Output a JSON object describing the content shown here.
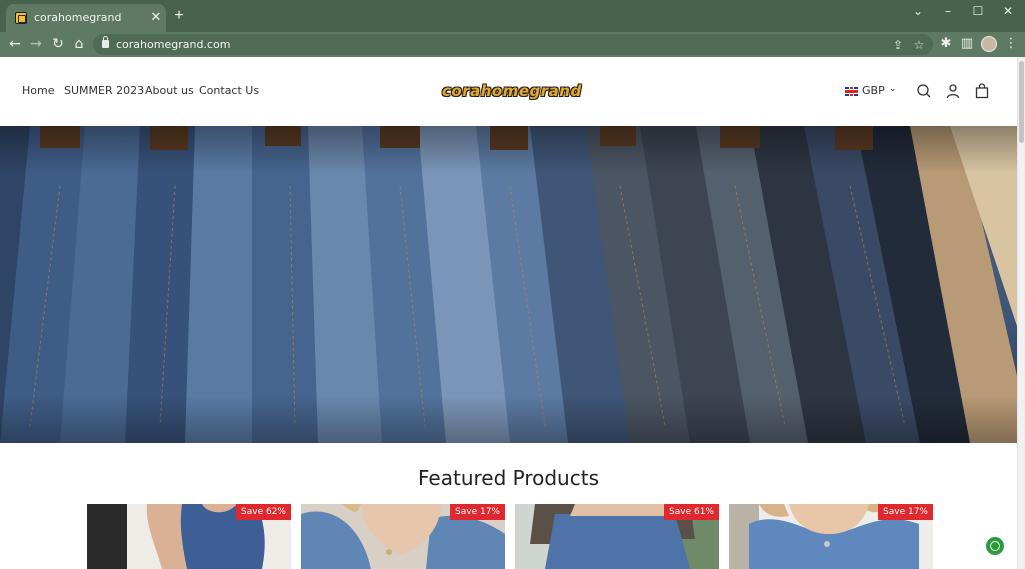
{
  "browser": {
    "tab_title": "corahomegrand",
    "tab_close": "✕",
    "new_tab": "+",
    "url": "corahomegrand.com",
    "window_controls": {
      "chevron": "⌄",
      "minimize": "–",
      "maximize": "☐",
      "close": "✕"
    },
    "nav": {
      "back": "←",
      "forward": "→",
      "reload": "↻",
      "home": "⌂"
    },
    "icons": {
      "share": "⇪",
      "star": "☆",
      "extensions": "✱",
      "sidepanel": "▥",
      "menu": "⋮"
    }
  },
  "site": {
    "nav_links": [
      "Home",
      "SUMMER 2023",
      "About us",
      "Contact Us"
    ],
    "logo_text": "corahomegrand",
    "currency": "GBP",
    "currency_chevron": "⌄"
  },
  "main": {
    "featured_title": "Featured Products",
    "products": [
      {
        "badge": "Save 62%",
        "image_icon": "product-dress-image"
      },
      {
        "badge": "Save 17%",
        "image_icon": "product-denim-shirt-image"
      },
      {
        "badge": "Save 61%",
        "image_icon": "product-denim-skirt-image"
      },
      {
        "badge": "Save 17%",
        "image_icon": "product-denim-top-image"
      }
    ]
  },
  "colors": {
    "chrome_titlebar": "#47634e",
    "chrome_toolbar": "#5f7a64",
    "badge_red": "#e0282f",
    "logo_orange": "#e8a62a",
    "chat_green": "#2a9d3a"
  }
}
